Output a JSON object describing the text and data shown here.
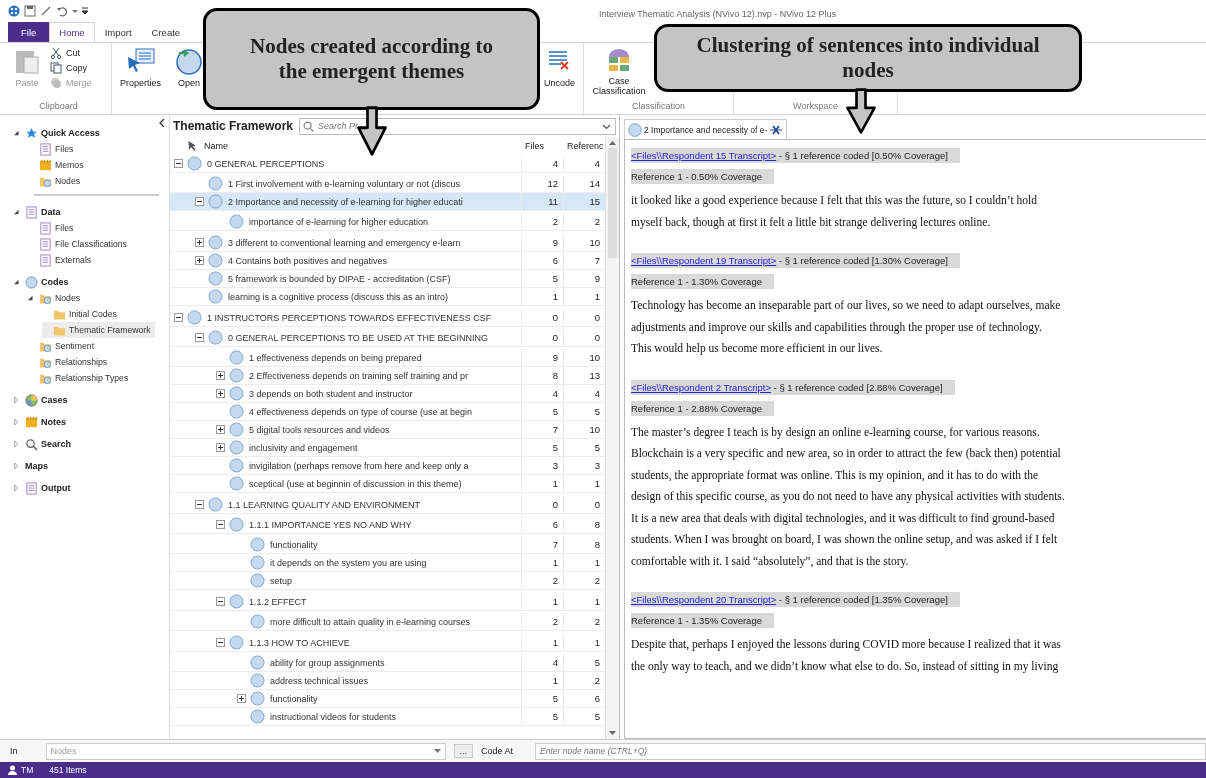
{
  "window": {
    "title": "Interview Thematic Analysis (NVivo 12).nvp - NVivo 12 Plus"
  },
  "ribbon_tabs": [
    {
      "label": "File",
      "kind": "file",
      "selected": false
    },
    {
      "label": "Home",
      "kind": "tab",
      "selected": true
    },
    {
      "label": "Import",
      "kind": "tab",
      "selected": false
    },
    {
      "label": "Create",
      "kind": "tab",
      "selected": false
    }
  ],
  "ribbon": {
    "paste": {
      "label": "Paste",
      "disabled": true
    },
    "cut": {
      "label": "Cut",
      "disabled": false
    },
    "copy": {
      "label": "Copy",
      "disabled": false
    },
    "merge": {
      "label": "Merge",
      "disabled": true
    },
    "clipboard_group": "Clipboard",
    "properties": "Properties",
    "open": "Open",
    "uncode": "Uncode",
    "case_classification": "Case Classification",
    "classification_group": "Classification",
    "workspace_group": "Workspace"
  },
  "navigation": {
    "sections": [
      {
        "label": "Quick Access",
        "kind": "star",
        "expanded": true,
        "items": [
          {
            "label": "Files",
            "kind": "files",
            "selected": false
          },
          {
            "label": "Memos",
            "kind": "memos",
            "selected": false
          },
          {
            "label": "Nodes",
            "kind": "nodes",
            "selected": false
          }
        ]
      },
      {
        "label": "Data",
        "kind": "data",
        "expanded": true,
        "items": [
          {
            "label": "Files",
            "kind": "files",
            "selected": false
          },
          {
            "label": "File Classifications",
            "kind": "classifications",
            "selected": false
          },
          {
            "label": "Externals",
            "kind": "externals",
            "selected": false
          }
        ]
      },
      {
        "label": "Codes",
        "kind": "codes",
        "expanded": true,
        "items": [
          {
            "label": "Nodes",
            "kind": "nodes",
            "selected": false,
            "expanded": true,
            "children": [
              {
                "label": "Initial Codes",
                "kind": "folder",
                "selected": false
              },
              {
                "label": "Thematic Framework",
                "kind": "folder",
                "selected": true
              }
            ]
          },
          {
            "label": "Sentiment",
            "kind": "sentiment",
            "selected": false
          },
          {
            "label": "Relationships",
            "kind": "relationships",
            "selected": false
          },
          {
            "label": "Relationship Types",
            "kind": "relationships",
            "selected": false
          }
        ]
      },
      {
        "label": "Cases",
        "kind": "cases",
        "expanded": false
      },
      {
        "label": "Notes",
        "kind": "notes",
        "expanded": false
      },
      {
        "label": "Search",
        "kind": "search",
        "expanded": false
      },
      {
        "label": "Maps",
        "kind": "maps",
        "expanded": false
      },
      {
        "label": "Output",
        "kind": "output",
        "expanded": false
      }
    ]
  },
  "node_list": {
    "title": "Thematic Framework",
    "search": {
      "placeholder": "Search Pr"
    },
    "columns": [
      "Name",
      "Files",
      "Referenc"
    ],
    "rows": [
      {
        "name": "0 GENERAL PERCEPTIONS",
        "files": "4",
        "references": "4",
        "expanded": true,
        "selected": false,
        "children": [
          {
            "name": "1 First involvement with e-learning voluntary or not (discus",
            "files": "12",
            "references": "14",
            "selected": false
          },
          {
            "name": "2 Importance and necessity of e-learning for higher educati",
            "files": "11",
            "references": "15",
            "expanded": true,
            "selected": true,
            "children": [
              {
                "name": "importance of e-learning for higher education",
                "files": "2",
                "references": "2",
                "selected": false
              }
            ]
          },
          {
            "name": "3 different to conventional learning and emergency e-learn",
            "files": "9",
            "references": "10",
            "expanded": false,
            "selected": false
          },
          {
            "name": "4 Contains both positives and negatives",
            "files": "6",
            "references": "7",
            "expanded": false,
            "selected": false
          },
          {
            "name": "5 framework is bounded by DIPAE - accreditation (CSF)",
            "files": "5",
            "references": "9",
            "selected": false
          },
          {
            "name": "learning is a cognitive process (discuss this as an intro)",
            "files": "1",
            "references": "1",
            "selected": false
          }
        ]
      },
      {
        "name": "1 INSTRUCTORS PERCEPTIONS TOWARDS EFFECTIVENESS CSF",
        "files": "0",
        "references": "0",
        "expanded": true,
        "selected": false,
        "children": [
          {
            "name": "0 GENERAL PERCEPTIONS TO BE USED AT THE BEGINNING",
            "files": "0",
            "references": "0",
            "expanded": true,
            "selected": false,
            "children": [
              {
                "name": "1 effectiveness depends on being prepared",
                "files": "9",
                "references": "10",
                "selected": false
              },
              {
                "name": "2 Effectiveness depends on training self training and pr",
                "files": "8",
                "references": "13",
                "expanded": false,
                "selected": false
              },
              {
                "name": "3 depends on both student and instructor",
                "files": "4",
                "references": "4",
                "expanded": false,
                "selected": false
              },
              {
                "name": "4 effectiveness depends on type of course (use at begin",
                "files": "5",
                "references": "5",
                "selected": false
              },
              {
                "name": "5 digital tools resources and videos",
                "files": "7",
                "references": "10",
                "expanded": false,
                "selected": false
              },
              {
                "name": "inclusivity and engagement",
                "files": "5",
                "references": "5",
                "expanded": false,
                "selected": false
              },
              {
                "name": "invigilation (perhaps remove from here and keep only a",
                "files": "3",
                "references": "3",
                "selected": false
              },
              {
                "name": "sceptical (use at beginnin of discussion in this theme)",
                "files": "1",
                "references": "1",
                "selected": false
              }
            ]
          },
          {
            "name": "1.1 LEARNING QUALITY AND ENVIRONMENT",
            "files": "0",
            "references": "0",
            "expanded": true,
            "selected": false,
            "children": [
              {
                "name": "1.1.1 IMPORTANCE YES NO AND WHY",
                "files": "6",
                "references": "8",
                "expanded": true,
                "selected": false,
                "children": [
                  {
                    "name": "functionality",
                    "files": "7",
                    "references": "8",
                    "selected": false
                  },
                  {
                    "name": "it depends on the system you are using",
                    "files": "1",
                    "references": "1",
                    "selected": false
                  },
                  {
                    "name": "setup",
                    "files": "2",
                    "references": "2",
                    "selected": false
                  }
                ]
              },
              {
                "name": "1.1.2 EFFECT",
                "files": "1",
                "references": "1",
                "expanded": true,
                "selected": false,
                "children": [
                  {
                    "name": "more difficult to attain quality in e-learning courses",
                    "files": "2",
                    "references": "2",
                    "selected": false
                  }
                ]
              },
              {
                "name": "1.1.3 HOW TO ACHIEVE",
                "files": "1",
                "references": "1",
                "expanded": true,
                "selected": false,
                "children": [
                  {
                    "name": "ability for group assignments",
                    "files": "4",
                    "references": "5",
                    "selected": false
                  },
                  {
                    "name": "address technical issues",
                    "files": "1",
                    "references": "2",
                    "selected": false
                  },
                  {
                    "name": "functionality",
                    "files": "5",
                    "references": "6",
                    "expanded": false,
                    "selected": false
                  },
                  {
                    "name": "instructional videos for students",
                    "files": "5",
                    "references": "5",
                    "selected": false
                  }
                ]
              }
            ]
          }
        ]
      }
    ]
  },
  "detail": {
    "tab": {
      "label": "2 Importance and necessity of e-"
    },
    "references": [
      {
        "source": "<Files\\\\Respondent 15 Transcript>",
        "summary": " - § 1 reference coded  [0.50% Coverage]",
        "reference": "Reference 1 - 0.50% Coverage",
        "lines": [
          "it looked like a good experience because I felt that this was the future, so I couldn’t hold",
          "myself back, though at first it felt a little bit strange delivering lectures online."
        ]
      },
      {
        "source": "<Files\\\\Respondent 19 Transcript>",
        "summary": " - § 1 reference coded  [1.30% Coverage]",
        "reference": "Reference 1 - 1.30% Coverage",
        "lines": [
          "Technology has become an inseparable part of our lives, so we need to adapt ourselves, make",
          "adjustments and improve our skills and capabilities through the proper use of technology.",
          "This would help us become more efficient in our lives."
        ]
      },
      {
        "source": "<Files\\\\Respondent 2 Transcript>",
        "summary": " - § 1 reference coded  [2.88% Coverage]",
        "reference": "Reference 1 - 2.88% Coverage",
        "lines": [
          "The master’s degree I teach is by design an online e-learning course, for various reasons.",
          "Blockchain is a very specific and new area, so in order to attract the few (back then) potential",
          "students, the appropriate format was online. This is my opinion, and it has to do with the",
          "design of this specific course, as you do not need to have any physical activities with students.",
          "It is a new area that deals with digital technologies, and it was difficult to find ground-based",
          "students. When I was brought on board, I was shown the online setup, and was asked if I felt",
          "comfortable with it. I said “absolutely”, and that is the story."
        ]
      },
      {
        "source": "<Files\\\\Respondent 20 Transcript>",
        "summary": " - § 1 reference coded  [1.35% Coverage]",
        "reference": "Reference 1 - 1.35% Coverage",
        "lines": [
          "Despite that, perhaps I enjoyed the lessons during COVID more because I realized that it was",
          "the only way to teach, and we didn’t know what else to do. So, instead of sitting in my living"
        ]
      }
    ]
  },
  "find_bar": {
    "in_label": "In",
    "in_value": "Nodes",
    "more": "...",
    "code_at_label": "Code At",
    "code_at": {
      "placeholder": "Enter node name (CTRL+Q)"
    }
  },
  "status_bar": {
    "user": "TM",
    "items": "451 Items"
  },
  "callouts": [
    {
      "text": "Nodes created according to the emergent themes"
    },
    {
      "text": "Clustering of sentences into individual nodes"
    }
  ]
}
